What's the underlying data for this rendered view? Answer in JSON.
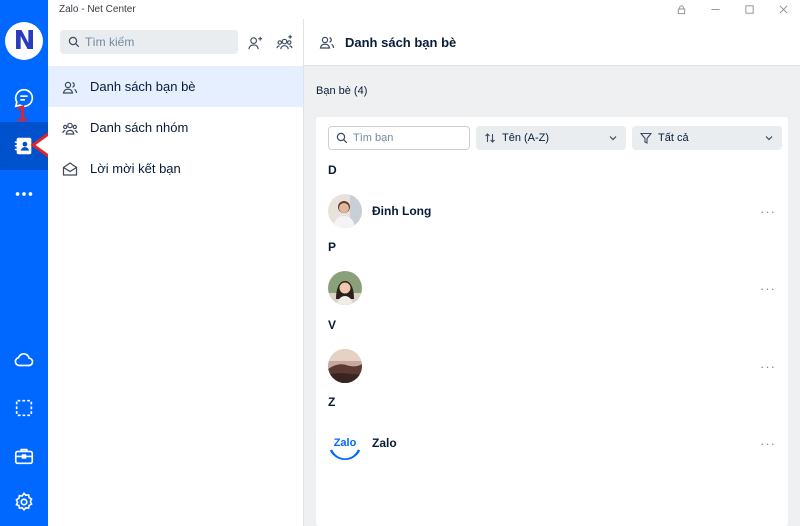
{
  "window": {
    "title": "Zalo - Net Center"
  },
  "nav": {
    "avatar_letter": "N",
    "annotation_number": "1",
    "items": [
      {
        "icon": "chat-icon"
      },
      {
        "icon": "contacts-icon",
        "active": true
      },
      {
        "icon": "more-icon"
      },
      {
        "icon": "cloud-icon"
      },
      {
        "icon": "screenshot-icon"
      },
      {
        "icon": "briefcase-icon"
      },
      {
        "icon": "settings-icon"
      }
    ]
  },
  "sidebar": {
    "search_placeholder": "Tìm kiếm",
    "menu": [
      {
        "label": "Danh sách bạn bè",
        "icon": "friends-icon",
        "active": true
      },
      {
        "label": "Danh sách nhóm",
        "icon": "group-icon"
      },
      {
        "label": "Lời mời kết bạn",
        "icon": "envelope-icon"
      }
    ]
  },
  "main": {
    "header_title": "Danh sách bạn bè",
    "friends_count_label": "Bạn bè (4)",
    "filter": {
      "search_placeholder": "Tìm bạn",
      "sort_label": "Tên (A-Z)",
      "filter_label": "Tất cả"
    },
    "groups": [
      {
        "letter": "D",
        "contacts": [
          {
            "name": "Đinh Long",
            "more": "···"
          }
        ]
      },
      {
        "letter": "P",
        "contacts": [
          {
            "name": "",
            "more": "···"
          }
        ]
      },
      {
        "letter": "V",
        "contacts": [
          {
            "name": "",
            "more": "···"
          }
        ]
      },
      {
        "letter": "Z",
        "contacts": [
          {
            "name": "Zalo",
            "more": "···",
            "avatar_text": "Zalo"
          }
        ]
      }
    ]
  },
  "colors": {
    "nav": "#0068ff",
    "active_item": "#e5efff",
    "annotation": "#e0242b"
  }
}
